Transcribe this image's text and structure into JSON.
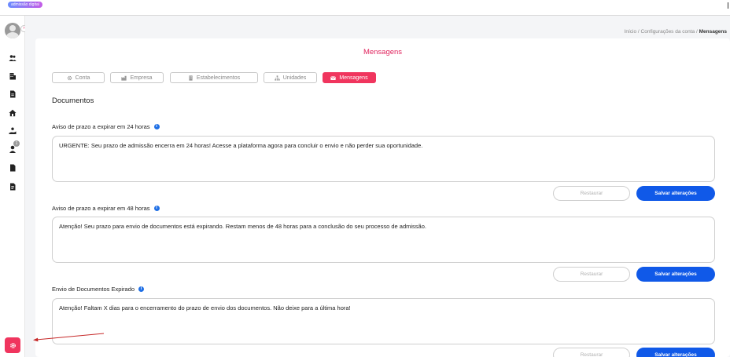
{
  "topbar": {
    "brand": "admissão digital"
  },
  "sidebar": {
    "collapse_icon": "chevron-right-icon",
    "items": [
      {
        "icon": "users-icon"
      },
      {
        "icon": "building-icon"
      },
      {
        "icon": "document-icon"
      },
      {
        "icon": "home-icon"
      },
      {
        "icon": "hand-holding-user-icon"
      },
      {
        "icon": "user-icon"
      },
      {
        "icon": "file-icon"
      },
      {
        "icon": "file-text-icon"
      }
    ],
    "notification_count": "1",
    "settings_icon": "gear-icon",
    "accent_color": "#f0355e"
  },
  "breadcrumb": {
    "home": "Início",
    "parent": "Configurações da conta",
    "current": "Mensagens"
  },
  "page": {
    "title": "Mensagens",
    "section_title": "Documentos"
  },
  "tabs": [
    {
      "label": "Conta",
      "icon": "gear-icon",
      "active": false
    },
    {
      "label": "Empresa",
      "icon": "factory-icon",
      "active": false
    },
    {
      "label": "Estabelecimentos",
      "icon": "building-icon",
      "active": false
    },
    {
      "label": "Unidades",
      "icon": "sitemap-icon",
      "active": false
    },
    {
      "label": "Mensagens",
      "icon": "envelope-icon",
      "active": true
    }
  ],
  "messages": [
    {
      "label": "Aviso de prazo a expirar em 24 horas",
      "text": "URGENTE: Seu prazo de admissão encerra em 24 horas! Acesse a plataforma agora para concluir o envio e não perder sua oportunidade.",
      "restore_label": "Restaurar",
      "save_label": "Salvar alterações"
    },
    {
      "label": "Aviso de prazo a expirar em 48 horas",
      "text": "Atenção! Seu prazo para envio de documentos está expirando. Restam menos de 48 horas para a conclusão do seu processo de admissão.",
      "restore_label": "Restaurar",
      "save_label": "Salvar alterações"
    },
    {
      "label": "Envio de Documentos Expirado",
      "text": "Atenção! Faltam X dias para o encerramento do prazo de envio dos documentos. Não deixe para a última hora!",
      "restore_label": "Restaurar",
      "save_label": "Salvar alterações"
    }
  ],
  "colors": {
    "primary": "#1059e8",
    "accent": "#e0245e",
    "info": "#1f6fe5"
  }
}
